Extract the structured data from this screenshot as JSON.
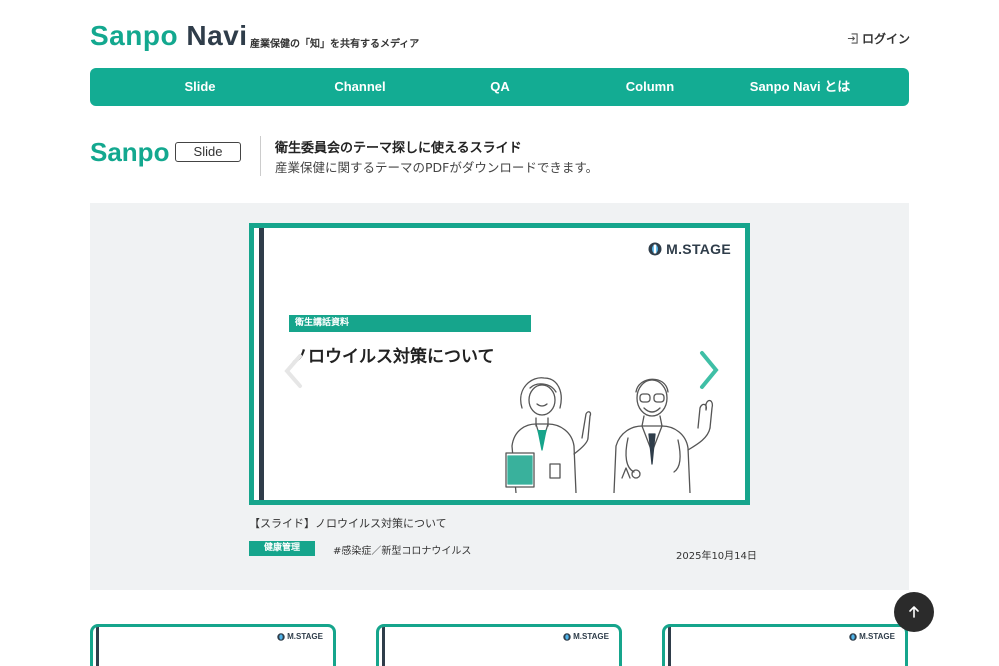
{
  "header": {
    "logo_sanpo": "Sanpo",
    "logo_navi": "Navi",
    "tagline": "産業保健の「知」を共有するメディア",
    "login_label": "ログイン"
  },
  "nav": {
    "items": [
      {
        "label": "Slide"
      },
      {
        "label": "Channel"
      },
      {
        "label": "QA"
      },
      {
        "label": "Column"
      },
      {
        "label": "Sanpo Navi とは"
      }
    ]
  },
  "section": {
    "logo": "Sanpo",
    "badge": "Slide",
    "title": "衛生委員会のテーマ探しに使えるスライド",
    "subtitle": "産業保健に関するテーマのPDFがダウンロードできます。"
  },
  "featured": {
    "brand": "M.STAGE",
    "slide_category": "衛生講話資料",
    "slide_title": "ノロウイルス対策について",
    "caption": "【スライド】ノロウイルス対策について",
    "category_tag": "健康管理",
    "hashtag": "#感染症／新型コロナウイルス",
    "date": "2025年10月14日"
  },
  "cards": [
    {
      "brand": "M.STAGE"
    },
    {
      "brand": "M.STAGE"
    },
    {
      "brand": "M.STAGE"
    }
  ],
  "colors": {
    "brand_green": "#13ac93",
    "dark_navy": "#2f3d4a",
    "panel_bg": "#f0f2f3"
  },
  "icons": {
    "login": "login-icon",
    "prev": "chevron-left-icon",
    "next": "chevron-right-icon",
    "to_top": "arrow-up-icon"
  }
}
